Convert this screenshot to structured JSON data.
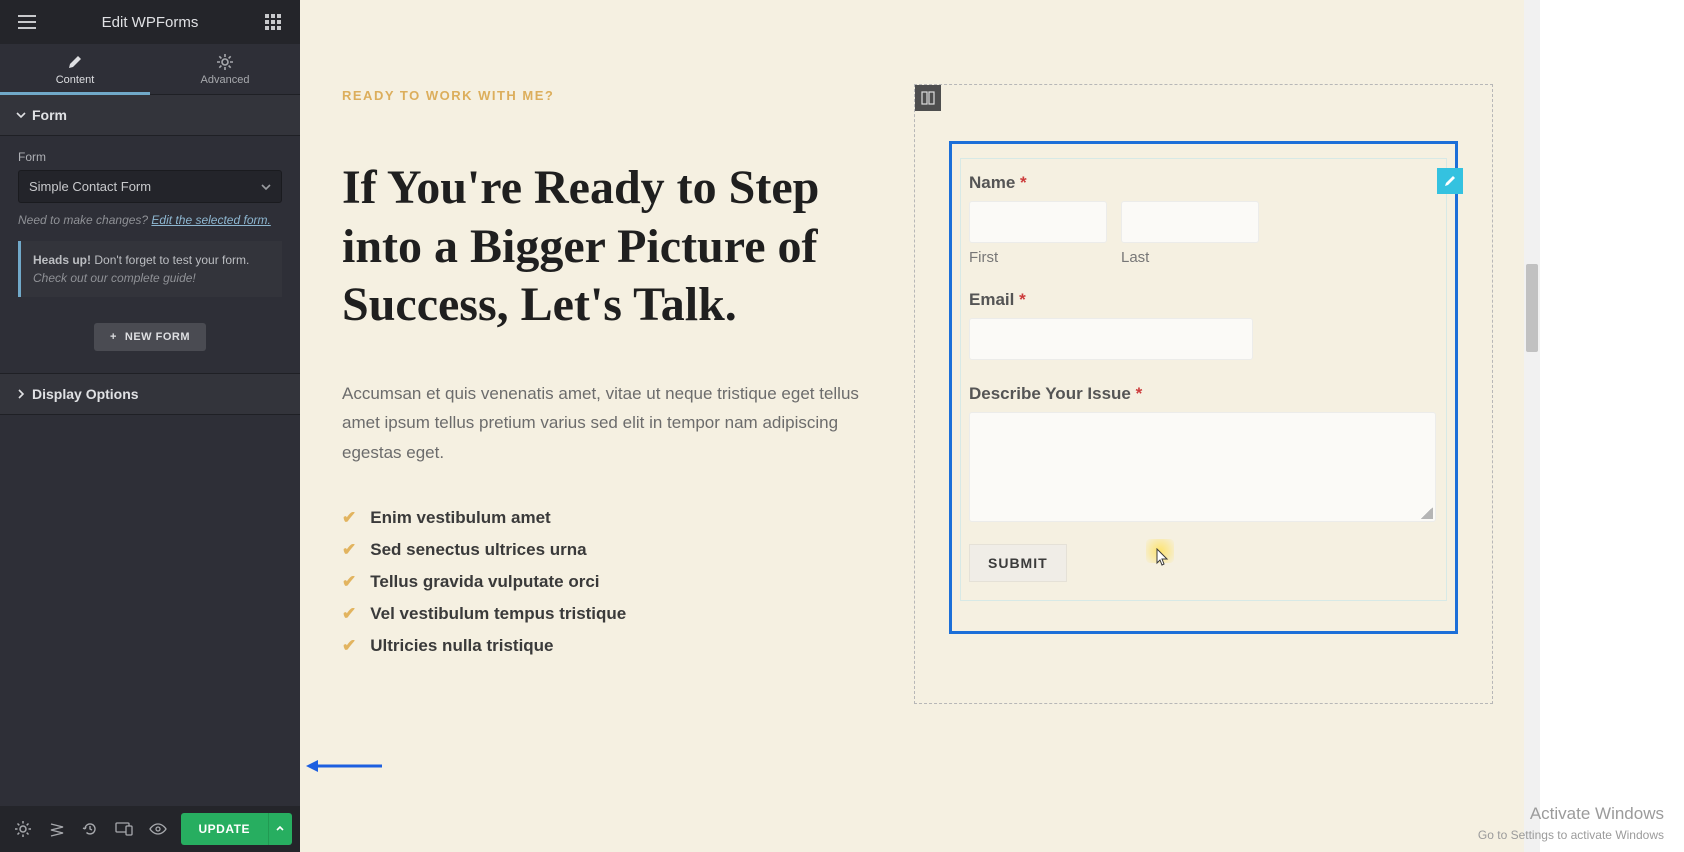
{
  "header": {
    "title": "Edit WPForms"
  },
  "tabs": {
    "content": "Content",
    "advanced": "Advanced"
  },
  "sections": {
    "form": "Form",
    "display": "Display Options"
  },
  "form_panel": {
    "label": "Form",
    "selected": "Simple Contact Form",
    "hint_prefix": "Need to make changes? ",
    "hint_link": "Edit the selected form.",
    "notice_bold": "Heads up!",
    "notice_rest": " Don't forget to test your form.",
    "notice_line2": "Check out our complete guide!",
    "new_form": "NEW FORM"
  },
  "footer": {
    "update": "UPDATE"
  },
  "content": {
    "eyebrow": "READY TO WORK WITH ME?",
    "heading": "If You're Ready to Step into a Bigger Picture of Success, Let's Talk.",
    "paragraph": "Accumsan et quis venenatis amet, vitae ut neque tristique eget tellus amet ipsum tellus pretium varius sed elit in tempor nam adipiscing egestas eget.",
    "list": [
      "Enim vestibulum amet",
      "Sed senectus ultrices urna",
      "Tellus gravida vulputate orci",
      "Vel vestibulum tempus tristique",
      "Ultricies nulla tristique"
    ]
  },
  "wpform": {
    "name_label": "Name ",
    "first": "First",
    "last": "Last",
    "email_label": "Email ",
    "issue_label": "Describe Your Issue ",
    "submit": "SUBMIT",
    "asterisk": "*"
  },
  "watermark": {
    "line1": "Activate Windows",
    "line2": "Go to Settings to activate Windows"
  }
}
